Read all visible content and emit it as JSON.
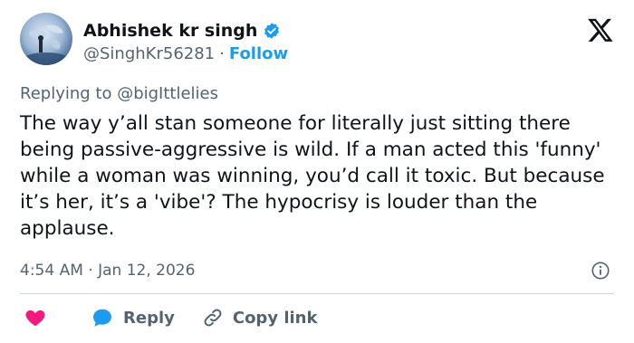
{
  "author": {
    "display_name": "Abhishek kr singh",
    "handle": "@SinghKr56281",
    "separator": "·",
    "follow_label": "Follow"
  },
  "reply_context": "Replying to @bigIttlelies",
  "tweet_text": "The way y’all stan someone for literally just sitting there being passive-aggressive is wild. If a man acted this 'funny' while a woman was winning, you’d call it toxic. But because it’s her, it’s a 'vibe'? The hypocrisy is louder than the applause.",
  "timestamp": "4:54 AM · Jan 12, 2026",
  "actions": {
    "reply_label": "Reply",
    "copy_link_label": "Copy link"
  },
  "icons": [
    "verified-badge-icon",
    "x-logo-icon",
    "info-icon",
    "heart-icon",
    "reply-bubble-icon",
    "link-icon"
  ],
  "colors": {
    "accent": "#1d9bf0",
    "like": "#f91880",
    "secondary_text": "#536471",
    "primary_text": "#0f1419",
    "divider": "#cfd9de"
  }
}
